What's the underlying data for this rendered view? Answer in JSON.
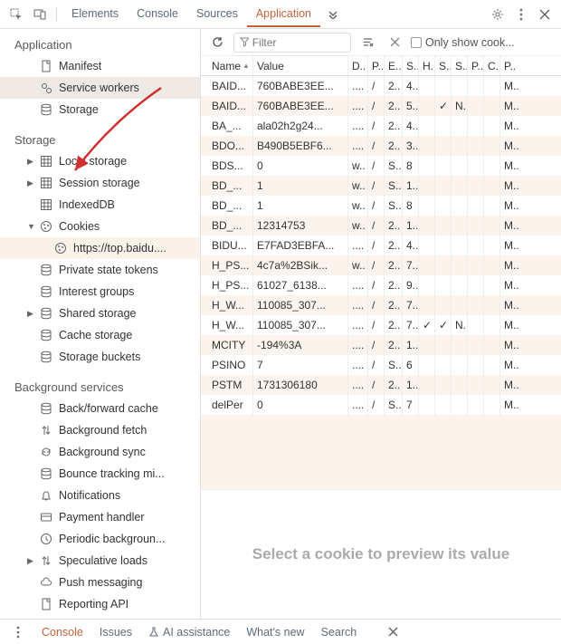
{
  "tabs": [
    "Elements",
    "Console",
    "Sources",
    "Application"
  ],
  "activeTab": 3,
  "sidebar": {
    "application": {
      "title": "Application",
      "items": [
        {
          "triangle": "none",
          "icon": "file",
          "label": "Manifest"
        },
        {
          "triangle": "none",
          "icon": "gears",
          "label": "Service workers",
          "selected": true
        },
        {
          "triangle": "none",
          "icon": "db",
          "label": "Storage"
        }
      ]
    },
    "storage": {
      "title": "Storage",
      "items": [
        {
          "triangle": "right",
          "icon": "grid",
          "label": "Local storage"
        },
        {
          "triangle": "right",
          "icon": "grid",
          "label": "Session storage"
        },
        {
          "triangle": "blank",
          "icon": "grid",
          "label": "IndexedDB"
        },
        {
          "triangle": "down",
          "icon": "cookie",
          "label": "Cookies"
        },
        {
          "triangle": "blank",
          "icon": "cookie",
          "label": "https://top.baidu....",
          "depth": 3,
          "domain": true
        },
        {
          "triangle": "blank",
          "icon": "db",
          "label": "Private state tokens"
        },
        {
          "triangle": "blank",
          "icon": "db",
          "label": "Interest groups"
        },
        {
          "triangle": "right",
          "icon": "db",
          "label": "Shared storage"
        },
        {
          "triangle": "blank",
          "icon": "db",
          "label": "Cache storage"
        },
        {
          "triangle": "blank",
          "icon": "db",
          "label": "Storage buckets"
        }
      ]
    },
    "bg": {
      "title": "Background services",
      "items": [
        {
          "triangle": "blank",
          "icon": "db",
          "label": "Back/forward cache"
        },
        {
          "triangle": "blank",
          "icon": "updown",
          "label": "Background fetch"
        },
        {
          "triangle": "blank",
          "icon": "sync",
          "label": "Background sync"
        },
        {
          "triangle": "blank",
          "icon": "db",
          "label": "Bounce tracking mi..."
        },
        {
          "triangle": "blank",
          "icon": "bell",
          "label": "Notifications"
        },
        {
          "triangle": "blank",
          "icon": "card",
          "label": "Payment handler"
        },
        {
          "triangle": "blank",
          "icon": "clock",
          "label": "Periodic backgroun..."
        },
        {
          "triangle": "right",
          "icon": "updown",
          "label": "Speculative loads"
        },
        {
          "triangle": "blank",
          "icon": "cloud",
          "label": "Push messaging"
        },
        {
          "triangle": "blank",
          "icon": "file",
          "label": "Reporting API"
        }
      ]
    }
  },
  "toolbar": {
    "filter_placeholder": "Filter",
    "only_label": "Only show cook..."
  },
  "table": {
    "headers": [
      "Name",
      "Value",
      "D..",
      "P..",
      "E..",
      "S..",
      "H..",
      "S..",
      "S..",
      "P..",
      "C..",
      "P.."
    ],
    "rows": [
      {
        "name": "BAID...",
        "value": "760BABE3EE...",
        "d": "....",
        "p": "/",
        "e": "2..",
        "s": "4..",
        "h": "",
        "ss": "",
        "sc": "",
        "pk": "",
        "cr": "",
        "pr": "M.."
      },
      {
        "name": "BAID...",
        "value": "760BABE3EE...",
        "d": "....",
        "p": "/",
        "e": "2..",
        "s": "5..",
        "h": "",
        "ss": "✓",
        "sc": "N..",
        "pk": "",
        "cr": "",
        "pr": "M.."
      },
      {
        "name": "BA_...",
        "value": "ala02h2g24...",
        "d": "....",
        "p": "/",
        "e": "2..",
        "s": "4..",
        "h": "",
        "ss": "",
        "sc": "",
        "pk": "",
        "cr": "",
        "pr": "M.."
      },
      {
        "name": "BDO...",
        "value": "B490B5EBF6...",
        "d": "....",
        "p": "/",
        "e": "2..",
        "s": "3..",
        "h": "",
        "ss": "",
        "sc": "",
        "pk": "",
        "cr": "",
        "pr": "M.."
      },
      {
        "name": "BDS...",
        "value": "0",
        "d": "w..",
        "p": "/",
        "e": "S..",
        "s": "8",
        "h": "",
        "ss": "",
        "sc": "",
        "pk": "",
        "cr": "",
        "pr": "M.."
      },
      {
        "name": "BD_...",
        "value": "1",
        "d": "w..",
        "p": "/",
        "e": "S..",
        "s": "1..",
        "h": "",
        "ss": "",
        "sc": "",
        "pk": "",
        "cr": "",
        "pr": "M.."
      },
      {
        "name": "BD_...",
        "value": "1",
        "d": "w..",
        "p": "/",
        "e": "S..",
        "s": "8",
        "h": "",
        "ss": "",
        "sc": "",
        "pk": "",
        "cr": "",
        "pr": "M.."
      },
      {
        "name": "BD_...",
        "value": "12314753",
        "d": "w..",
        "p": "/",
        "e": "2..",
        "s": "1..",
        "h": "",
        "ss": "",
        "sc": "",
        "pk": "",
        "cr": "",
        "pr": "M.."
      },
      {
        "name": "BIDU...",
        "value": "E7FAD3EBFA...",
        "d": "....",
        "p": "/",
        "e": "2..",
        "s": "4..",
        "h": "",
        "ss": "",
        "sc": "",
        "pk": "",
        "cr": "",
        "pr": "M.."
      },
      {
        "name": "H_PS...",
        "value": "4c7a%2BSik...",
        "d": "w..",
        "p": "/",
        "e": "2..",
        "s": "7..",
        "h": "",
        "ss": "",
        "sc": "",
        "pk": "",
        "cr": "",
        "pr": "M.."
      },
      {
        "name": "H_PS...",
        "value": "61027_6138...",
        "d": "....",
        "p": "/",
        "e": "2..",
        "s": "9..",
        "h": "",
        "ss": "",
        "sc": "",
        "pk": "",
        "cr": "",
        "pr": "M.."
      },
      {
        "name": "H_W...",
        "value": "110085_307...",
        "d": "....",
        "p": "/",
        "e": "2..",
        "s": "7..",
        "h": "",
        "ss": "",
        "sc": "",
        "pk": "",
        "cr": "",
        "pr": "M.."
      },
      {
        "name": "H_W...",
        "value": "110085_307...",
        "d": "....",
        "p": "/",
        "e": "2..",
        "s": "7..",
        "h": "✓",
        "ss": "✓",
        "sc": "N..",
        "pk": "",
        "cr": "",
        "pr": "M.."
      },
      {
        "name": "MCITY",
        "value": "-194%3A",
        "d": "....",
        "p": "/",
        "e": "2..",
        "s": "1..",
        "h": "",
        "ss": "",
        "sc": "",
        "pk": "",
        "cr": "",
        "pr": "M.."
      },
      {
        "name": "PSINO",
        "value": "7",
        "d": "....",
        "p": "/",
        "e": "S..",
        "s": "6",
        "h": "",
        "ss": "",
        "sc": "",
        "pk": "",
        "cr": "",
        "pr": "M.."
      },
      {
        "name": "PSTM",
        "value": "1731306180",
        "d": "....",
        "p": "/",
        "e": "2..",
        "s": "1..",
        "h": "",
        "ss": "",
        "sc": "",
        "pk": "",
        "cr": "",
        "pr": "M.."
      },
      {
        "name": "delPer",
        "value": "0",
        "d": "....",
        "p": "/",
        "e": "S..",
        "s": "7",
        "h": "",
        "ss": "",
        "sc": "",
        "pk": "",
        "cr": "",
        "pr": "M.."
      }
    ]
  },
  "preview_msg": "Select a cookie to preview its value",
  "bottombar": [
    "Console",
    "Issues",
    "AI assistance",
    "What's new",
    "Search"
  ]
}
